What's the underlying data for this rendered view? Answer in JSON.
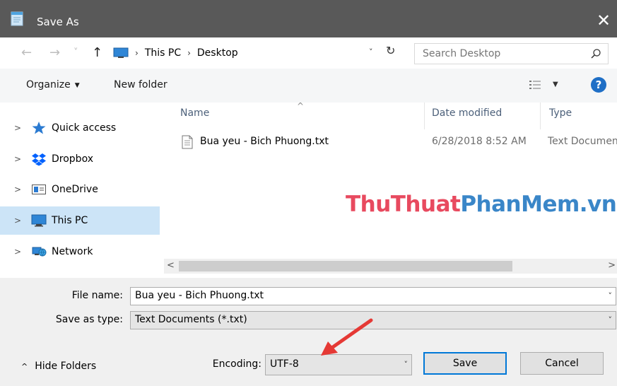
{
  "window": {
    "title": "Save As",
    "close_glyph": "✕"
  },
  "address": {
    "back_glyph": "←",
    "forward_glyph": "→",
    "recent_glyph": "˅",
    "up_glyph": "↑",
    "crumbs": [
      "This PC",
      "Desktop"
    ],
    "separator_glyph": "›",
    "dropdown_glyph": "˅",
    "refresh_glyph": "↻"
  },
  "search": {
    "placeholder": "Search Desktop"
  },
  "toolbar": {
    "organize_label": "Organize",
    "organize_dd": "▼",
    "new_folder_label": "New folder",
    "view_dd": "▼",
    "help_label": "?"
  },
  "nav": {
    "chevron_glyph": ">",
    "items": [
      {
        "label": "Quick access",
        "icon": "star-icon"
      },
      {
        "label": "Dropbox",
        "icon": "dropbox-icon"
      },
      {
        "label": "OneDrive",
        "icon": "onedrive-icon"
      },
      {
        "label": "This PC",
        "icon": "computer-icon",
        "selected": true
      },
      {
        "label": "Network",
        "icon": "network-icon"
      }
    ]
  },
  "filelist": {
    "sort_glyph": "^",
    "columns": {
      "name": "Name",
      "date": "Date modified",
      "type": "Type"
    },
    "rows": [
      {
        "name": "Bua yeu - Bich Phuong.txt",
        "date": "6/28/2018 8:52 AM",
        "type": "Text Documen"
      }
    ],
    "scroll_left_glyph": "<",
    "scroll_right_glyph": ">"
  },
  "watermark": {
    "part1": "ThuThuat",
    "part2": "PhanMem.vn"
  },
  "form": {
    "file_name_label": "File name:",
    "file_name_value": "Bua yeu - Bich Phuong.txt",
    "save_as_type_label": "Save as type:",
    "save_as_type_value": "Text Documents (*.txt)",
    "encoding_label": "Encoding:",
    "encoding_value": "UTF-8",
    "combo_dd_glyph": "˅"
  },
  "footer": {
    "hide_folders_caret": "^",
    "hide_folders_label": "Hide Folders",
    "save_label": "Save",
    "cancel_label": "Cancel"
  },
  "colors": {
    "titlebar": "#595959",
    "selection": "#cce4f7",
    "accent": "#0078d7",
    "annotation_arrow": "#e53935",
    "watermark_red": "#e84a5f",
    "watermark_blue": "#3a86c8"
  }
}
